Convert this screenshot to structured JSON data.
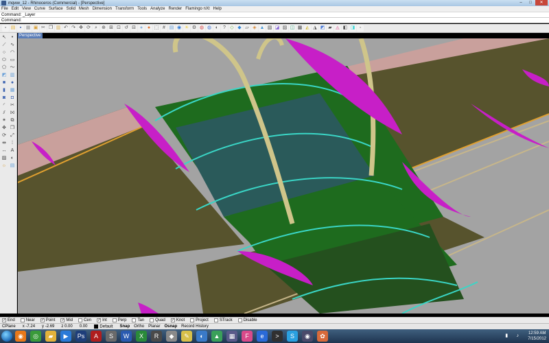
{
  "window": {
    "title": "mqww_12 - Rhinoceros (Commercial) - [Perspective]",
    "controls": [
      "–",
      "□",
      "✕"
    ]
  },
  "menu": [
    "File",
    "Edit",
    "View",
    "Curve",
    "Surface",
    "Solid",
    "Mesh",
    "Dimension",
    "Transform",
    "Tools",
    "Analyze",
    "Render",
    "Flamingo nXt",
    "Help"
  ],
  "command": {
    "history": "Command: _Layer",
    "prompt_label": "Command:",
    "input_value": ""
  },
  "toolbar_icons": [
    {
      "name": "new-file-icon",
      "glyph": "▫",
      "color": "#ffffff"
    },
    {
      "name": "open-file-icon",
      "glyph": "▤",
      "color": "#e2b23a"
    },
    {
      "name": "save-icon",
      "glyph": "▪",
      "color": "#3b62b0"
    },
    {
      "name": "print-icon",
      "glyph": "▦",
      "color": "#9a9a9a"
    },
    {
      "name": "import-icon",
      "glyph": "▣",
      "color": "#d9a13a"
    },
    {
      "name": "cut-icon",
      "glyph": "✂",
      "color": "#e9e9e9"
    },
    {
      "name": "copy-icon",
      "glyph": "❐",
      "color": "#e9e9e9"
    },
    {
      "name": "paste-icon",
      "glyph": "▥",
      "color": "#d8b050"
    },
    {
      "name": "undo-icon",
      "glyph": "↶",
      "color": "#e9e9e9"
    },
    {
      "name": "redo-icon",
      "glyph": "↷",
      "color": "#e9e9e9"
    },
    {
      "name": "pan-icon",
      "glyph": "✥",
      "color": "#e9e9e9"
    },
    {
      "name": "rotate-view-icon",
      "glyph": "⟳",
      "color": "#e9e9e9"
    },
    {
      "name": "zoom-icon",
      "glyph": "⌕",
      "color": "#e9e9e9"
    },
    {
      "name": "zoom-window-icon",
      "glyph": "⊕",
      "color": "#e9e9e9"
    },
    {
      "name": "zoom-extents-icon",
      "glyph": "⊞",
      "color": "#e9e9e9"
    },
    {
      "name": "zoom-selected-icon",
      "glyph": "⊡",
      "color": "#e9e9e9"
    },
    {
      "name": "undo-view-icon",
      "glyph": "↺",
      "color": "#e9e9e9"
    },
    {
      "name": "viewport-layout-icon",
      "glyph": "⊟",
      "color": "#e9e9e9"
    },
    {
      "name": "shaded-icon",
      "glyph": "●",
      "color": "#8db6e0"
    },
    {
      "name": "rendered-icon",
      "glyph": "●",
      "color": "#e57a3a"
    },
    {
      "name": "select-icon",
      "glyph": "⬚",
      "color": "#e9e9e9"
    },
    {
      "name": "grid-snap-icon",
      "glyph": "#",
      "color": "#e9e9e9"
    },
    {
      "name": "layer-icon",
      "glyph": "▤",
      "color": "#6aa0d8"
    },
    {
      "name": "properties-icon",
      "glyph": "◉",
      "color": "#2f7ad6"
    },
    {
      "name": "light-icon",
      "glyph": "☀",
      "color": "#f0d04a"
    },
    {
      "name": "options-icon",
      "glyph": "⚙",
      "color": "#e9e9e9"
    },
    {
      "name": "color-icon",
      "glyph": "◍",
      "color": "#d84a4a"
    },
    {
      "name": "material-icon",
      "glyph": "◍",
      "color": "#4a7ad8"
    },
    {
      "name": "analyze-icon",
      "glyph": "◐",
      "color": "#e9e9e9"
    },
    {
      "name": "help-icon",
      "glyph": "?",
      "color": "#e9e9e9"
    },
    {
      "name": "toolbar-icon-31",
      "glyph": "◇",
      "color": "#6ab04a"
    },
    {
      "name": "toolbar-icon-32",
      "glyph": "◆",
      "color": "#3a8ad8"
    },
    {
      "name": "toolbar-icon-33",
      "glyph": "▱",
      "color": "#e9e9e9"
    },
    {
      "name": "toolbar-icon-34",
      "glyph": "◈",
      "color": "#d88a3a"
    },
    {
      "name": "toolbar-icon-35",
      "glyph": "▲",
      "color": "#4a9ad8"
    },
    {
      "name": "toolbar-icon-36",
      "glyph": "▧",
      "color": "#e9e9e9"
    },
    {
      "name": "toolbar-icon-37",
      "glyph": "◪",
      "color": "#8a6ad8"
    },
    {
      "name": "toolbar-icon-38",
      "glyph": "▨",
      "color": "#e9e9e9"
    },
    {
      "name": "toolbar-icon-39",
      "glyph": "◫",
      "color": "#4ab08a"
    },
    {
      "name": "toolbar-icon-40",
      "glyph": "▩",
      "color": "#e9e9e9"
    },
    {
      "name": "toolbar-icon-41",
      "glyph": "◭",
      "color": "#d8c04a"
    },
    {
      "name": "toolbar-icon-42",
      "glyph": "◮",
      "color": "#e9e9e9"
    },
    {
      "name": "toolbar-icon-43",
      "glyph": "◩",
      "color": "#4a7ad8"
    },
    {
      "name": "toolbar-icon-44",
      "glyph": "▰",
      "color": "#e9e9e9"
    },
    {
      "name": "toolbar-icon-45",
      "glyph": "◬",
      "color": "#d84a8a"
    },
    {
      "name": "toolbar-icon-46",
      "glyph": "◧",
      "color": "#e9e9e9"
    },
    {
      "name": "toolbar-icon-47",
      "glyph": "◨",
      "color": "#4ad8d8"
    },
    {
      "name": "toolbar-icon-48",
      "glyph": "◦",
      "color": "#e9e9e9"
    }
  ],
  "side_icons": [
    {
      "name": "select-arrow-icon",
      "glyph": "↖",
      "color": "#e9e9e9"
    },
    {
      "name": "point-icon",
      "glyph": "•",
      "color": "#e9e9e9"
    },
    {
      "name": "polyline-icon",
      "glyph": "⟋",
      "color": "#e9e9e9"
    },
    {
      "name": "curve-icon",
      "glyph": "∿",
      "color": "#e9e9e9"
    },
    {
      "name": "circle-icon",
      "glyph": "○",
      "color": "#e9e9e9"
    },
    {
      "name": "arc-icon",
      "glyph": "◠",
      "color": "#e9e9e9"
    },
    {
      "name": "ellipse-icon",
      "glyph": "⬭",
      "color": "#e9e9e9"
    },
    {
      "name": "rectangle-icon",
      "glyph": "▭",
      "color": "#e9e9e9"
    },
    {
      "name": "polygon-icon",
      "glyph": "⬠",
      "color": "#e9e9e9"
    },
    {
      "name": "freeform-icon",
      "glyph": "〜",
      "color": "#e9e9e9"
    },
    {
      "name": "surface-icon",
      "glyph": "◩",
      "color": "#6aa0d8"
    },
    {
      "name": "extrude-icon",
      "glyph": "▥",
      "color": "#6aa0d8"
    },
    {
      "name": "box-icon",
      "glyph": "■",
      "color": "#3b62b0"
    },
    {
      "name": "sphere-icon",
      "glyph": "●",
      "color": "#3b62b0"
    },
    {
      "name": "cylinder-icon",
      "glyph": "▮",
      "color": "#3b62b0"
    },
    {
      "name": "mesh-icon",
      "glyph": "▦",
      "color": "#6aa0d8"
    },
    {
      "name": "boolean-union-icon",
      "glyph": "◙",
      "color": "#3b62b0"
    },
    {
      "name": "boolean-diff-icon",
      "glyph": "◘",
      "color": "#3b62b0"
    },
    {
      "name": "fillet-icon",
      "glyph": "◜",
      "color": "#e9e9e9"
    },
    {
      "name": "trim-icon",
      "glyph": "✂",
      "color": "#e9e9e9"
    },
    {
      "name": "split-icon",
      "glyph": "⫽",
      "color": "#e9e9e9"
    },
    {
      "name": "join-icon",
      "glyph": "⨝",
      "color": "#e9e9e9"
    },
    {
      "name": "explode-icon",
      "glyph": "✴",
      "color": "#e9e9e9"
    },
    {
      "name": "group-icon",
      "glyph": "⧉",
      "color": "#e9e9e9"
    },
    {
      "name": "move-icon",
      "glyph": "✥",
      "color": "#e9e9e9"
    },
    {
      "name": "copy-obj-icon",
      "glyph": "❐",
      "color": "#e9e9e9"
    },
    {
      "name": "rotate-icon",
      "glyph": "⟳",
      "color": "#e9e9e9"
    },
    {
      "name": "scale-icon",
      "glyph": "⤢",
      "color": "#e9e9e9"
    },
    {
      "name": "mirror-icon",
      "glyph": "⇹",
      "color": "#e9e9e9"
    },
    {
      "name": "array-icon",
      "glyph": "⁞",
      "color": "#e9e9e9"
    },
    {
      "name": "dimension-icon",
      "glyph": "↔",
      "color": "#e9e9e9"
    },
    {
      "name": "text-icon",
      "glyph": "A",
      "color": "#e9e9e9"
    },
    {
      "name": "hatch-icon",
      "glyph": "▨",
      "color": "#e9e9e9"
    },
    {
      "name": "analyze-side-icon",
      "glyph": "◐",
      "color": "#e9e9e9"
    },
    {
      "name": "render-side-icon",
      "glyph": "☼",
      "color": "#d8a03a"
    },
    {
      "name": "layers-side-icon",
      "glyph": "▤",
      "color": "#6aa0d8"
    }
  ],
  "viewport": {
    "label": "Perspective"
  },
  "osnaps": [
    {
      "label": "End",
      "checked": true
    },
    {
      "label": "Near",
      "checked": false
    },
    {
      "label": "Point",
      "checked": true
    },
    {
      "label": "Mid",
      "checked": true
    },
    {
      "label": "Cen",
      "checked": false
    },
    {
      "label": "Int",
      "checked": true
    },
    {
      "label": "Perp",
      "checked": false
    },
    {
      "label": "Tan",
      "checked": false
    },
    {
      "label": "Quad",
      "checked": false
    },
    {
      "label": "Knot",
      "checked": true
    },
    {
      "label": "Project",
      "checked": false
    },
    {
      "label": "STrack",
      "checked": false
    },
    {
      "label": "Disable",
      "checked": false
    }
  ],
  "status": {
    "cplane": "CPlane",
    "x": "x -7.24",
    "y": "y -2.69",
    "z": "z 0.00",
    "extra": "0.00",
    "layer": "Default",
    "panes": [
      {
        "label": "Snap",
        "bold": true
      },
      {
        "label": "Ortho",
        "bold": false
      },
      {
        "label": "Planar",
        "bold": false
      },
      {
        "label": "Osnap",
        "bold": true
      },
      {
        "label": "Record History",
        "bold": false
      }
    ]
  },
  "taskbar": {
    "apps": [
      {
        "name": "firefox-icon",
        "glyph": "◉",
        "color": "#e8781a"
      },
      {
        "name": "chrome-icon",
        "glyph": "◎",
        "color": "#3a9a3a"
      },
      {
        "name": "folder-icon",
        "glyph": "▰",
        "color": "#e2b23a"
      },
      {
        "name": "media-player-icon",
        "glyph": "▶",
        "color": "#2a7ad8"
      },
      {
        "name": "photoshop-icon",
        "glyph": "Ps",
        "color": "#1e3e7a"
      },
      {
        "name": "acrobat-icon",
        "glyph": "A",
        "color": "#b01e1e"
      },
      {
        "name": "sketch-icon",
        "glyph": "S",
        "color": "#6a6a6a"
      },
      {
        "name": "word-icon",
        "glyph": "W",
        "color": "#2a5ab0"
      },
      {
        "name": "excel-icon",
        "glyph": "X",
        "color": "#2a8a3a"
      },
      {
        "name": "rhino-icon",
        "glyph": "R",
        "color": "#4a4a4a"
      },
      {
        "name": "game-icon",
        "glyph": "◆",
        "color": "#8a8a8a"
      },
      {
        "name": "notes-icon",
        "glyph": "✎",
        "color": "#d8c04a"
      },
      {
        "name": "wifi-app-icon",
        "glyph": "◐",
        "color": "#3a7ac8"
      },
      {
        "name": "drive-icon",
        "glyph": "▲",
        "color": "#3aa05a"
      },
      {
        "name": "calc-icon",
        "glyph": "▦",
        "color": "#5a5a8a"
      },
      {
        "name": "flamingo-icon",
        "glyph": "F",
        "color": "#d84a8a"
      },
      {
        "name": "browser-icon",
        "glyph": "e",
        "color": "#2a6ad8"
      },
      {
        "name": "terminal-icon",
        "glyph": ">",
        "color": "#303030"
      },
      {
        "name": "skype-icon",
        "glyph": "S",
        "color": "#2aa0e0"
      },
      {
        "name": "camera-icon",
        "glyph": "◉",
        "color": "#4a4a6a"
      },
      {
        "name": "paint-icon",
        "glyph": "✿",
        "color": "#d86a3a"
      }
    ],
    "time": "12:59 AM",
    "date": "7/15/2012"
  }
}
